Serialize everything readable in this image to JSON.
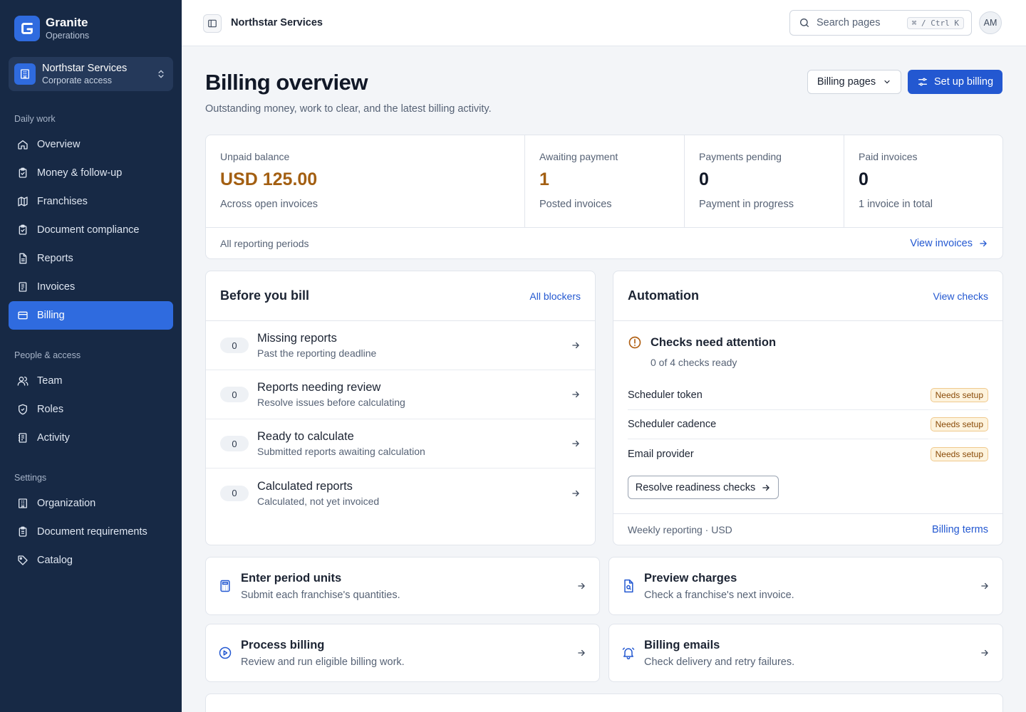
{
  "brand": {
    "name": "Granite",
    "subtitle": "Operations"
  },
  "org_switcher": {
    "name": "Northstar Services",
    "subtitle": "Corporate access"
  },
  "nav": {
    "daily_label": "Daily work",
    "daily": [
      {
        "label": "Overview",
        "icon": "home-icon"
      },
      {
        "label": "Money & follow-up",
        "icon": "clipboard-check-icon"
      },
      {
        "label": "Franchises",
        "icon": "map-icon"
      },
      {
        "label": "Document compliance",
        "icon": "clipboard-check-icon"
      },
      {
        "label": "Reports",
        "icon": "file-text-icon"
      },
      {
        "label": "Invoices",
        "icon": "receipt-icon"
      },
      {
        "label": "Billing",
        "icon": "credit-card-icon",
        "active": true
      }
    ],
    "people_label": "People & access",
    "people": [
      {
        "label": "Team",
        "icon": "users-icon"
      },
      {
        "label": "Roles",
        "icon": "shield-icon"
      },
      {
        "label": "Activity",
        "icon": "history-icon"
      }
    ],
    "settings_label": "Settings",
    "settings": [
      {
        "label": "Organization",
        "icon": "building-icon"
      },
      {
        "label": "Document requirements",
        "icon": "clipboard-list-icon"
      },
      {
        "label": "Catalog",
        "icon": "tag-icon"
      }
    ]
  },
  "topbar": {
    "org": "Northstar Services",
    "search_placeholder": "Search pages",
    "shortcut": "⌘ / Ctrl K",
    "avatar": "AM"
  },
  "header": {
    "title": "Billing overview",
    "subtitle": "Outstanding money, work to clear, and the latest billing activity.",
    "pages_button": "Billing pages",
    "setup_button": "Set up billing"
  },
  "stats": {
    "items": [
      {
        "label": "Unpaid balance",
        "value": "USD 125.00",
        "note": "Across open invoices"
      },
      {
        "label": "Awaiting payment",
        "value": "1",
        "note": "Posted invoices"
      },
      {
        "label": "Payments pending",
        "value": "0",
        "note": "Payment in progress"
      },
      {
        "label": "Paid invoices",
        "value": "0",
        "note": "1 invoice in total"
      }
    ],
    "period": "All reporting periods",
    "view_invoices": "View invoices"
  },
  "before_bill": {
    "title": "Before you bill",
    "link": "All blockers",
    "rows": [
      {
        "count": "0",
        "title": "Missing reports",
        "subtitle": "Past the reporting deadline"
      },
      {
        "count": "0",
        "title": "Reports needing review",
        "subtitle": "Resolve issues before calculating"
      },
      {
        "count": "0",
        "title": "Ready to calculate",
        "subtitle": "Submitted reports awaiting calculation"
      },
      {
        "count": "0",
        "title": "Calculated reports",
        "subtitle": "Calculated, not yet invoiced"
      }
    ]
  },
  "automation": {
    "title": "Automation",
    "link": "View checks",
    "status_title": "Checks need attention",
    "status_sub": "0 of 4 checks ready",
    "checks": [
      {
        "name": "Scheduler token",
        "status": "Needs setup"
      },
      {
        "name": "Scheduler cadence",
        "status": "Needs setup"
      },
      {
        "name": "Email provider",
        "status": "Needs setup"
      }
    ],
    "resolve_button": "Resolve readiness checks",
    "footer": "Weekly reporting · USD",
    "terms_link": "Billing terms"
  },
  "actions": [
    {
      "title": "Enter period units",
      "subtitle": "Submit each franchise's quantities.",
      "icon": "calculator-icon"
    },
    {
      "title": "Preview charges",
      "subtitle": "Check a franchise's next invoice.",
      "icon": "file-search-icon"
    },
    {
      "title": "Process billing",
      "subtitle": "Review and run eligible billing work.",
      "icon": "play-circle-icon"
    },
    {
      "title": "Billing emails",
      "subtitle": "Check delivery and retry failures.",
      "icon": "bell-ring-icon"
    }
  ],
  "colors": {
    "sidebar": "#172945",
    "accent": "#2358d1",
    "warning": "#a35f12"
  }
}
